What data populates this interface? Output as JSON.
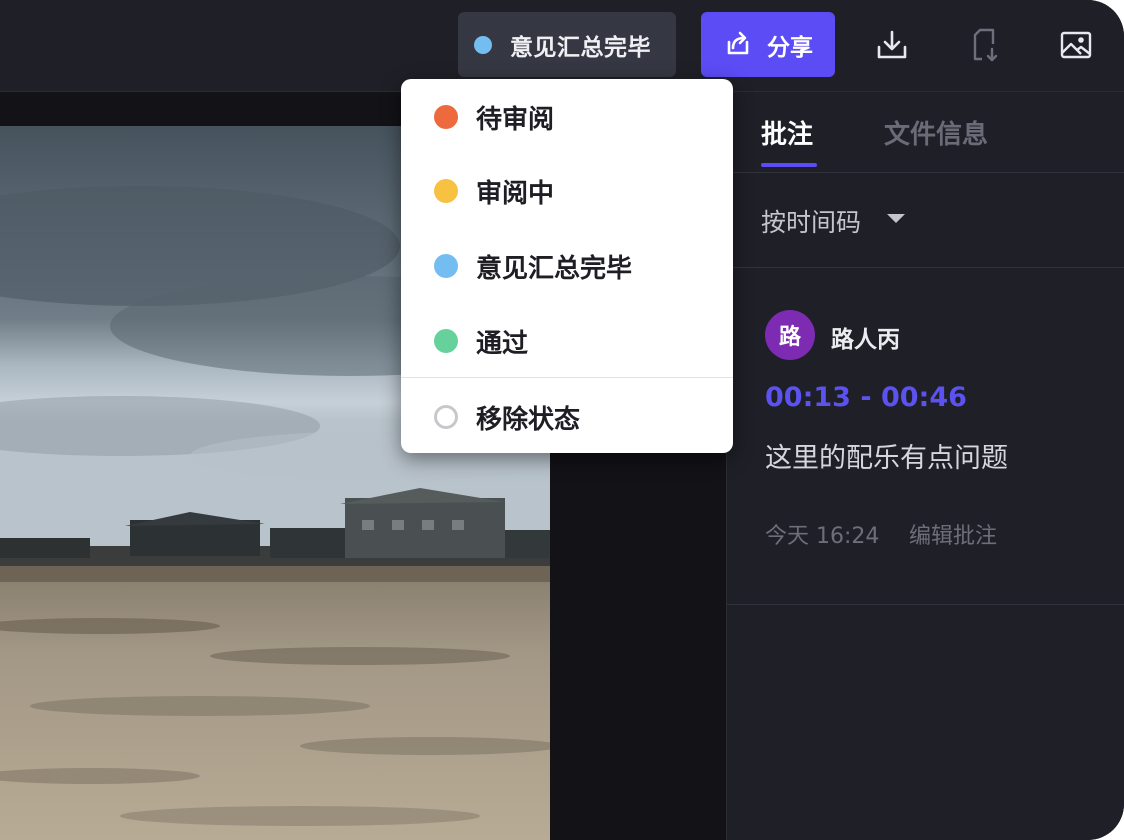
{
  "topbar": {
    "status_label": "意见汇总完毕",
    "status_color": "#74bdf0",
    "share_label": "分享",
    "share_color": "#5b4cf5",
    "icons": [
      "share-icon",
      "download-icon",
      "file-download-icon",
      "image-icon"
    ]
  },
  "status_menu": {
    "items": [
      {
        "label": "待审阅",
        "color": "#ec6a3d"
      },
      {
        "label": "审阅中",
        "color": "#f7c142"
      },
      {
        "label": "意见汇总完毕",
        "color": "#74bdf0"
      },
      {
        "label": "通过",
        "color": "#66d19a"
      }
    ],
    "remove_label": "移除状态"
  },
  "panel": {
    "tabs": [
      {
        "label": "批注",
        "active": true
      },
      {
        "label": "文件信息",
        "active": false
      }
    ],
    "sort_label": "按时间码",
    "comments": [
      {
        "avatar_text": "路",
        "avatar_color": "#7d2bb3",
        "author": "路人丙",
        "time_range": "00:13 - 00:46",
        "text": "这里的配乐有点问题",
        "time": "今天 16:24",
        "edit_label": "编辑批注"
      }
    ]
  }
}
